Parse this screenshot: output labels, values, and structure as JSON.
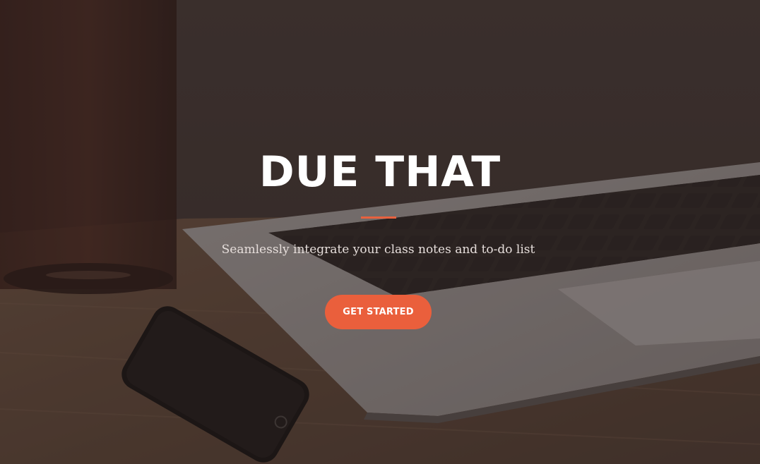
{
  "hero": {
    "title": "DUE THAT",
    "subtitle": "Seamlessly integrate your class notes and to-do list",
    "cta_label": "GET STARTED"
  },
  "colors": {
    "accent": "#ea5f3c",
    "title_text": "#ffffff",
    "subtitle_text": "#e6dedb"
  },
  "background": {
    "scene": "desk-with-laptop-phone-and-glass"
  }
}
